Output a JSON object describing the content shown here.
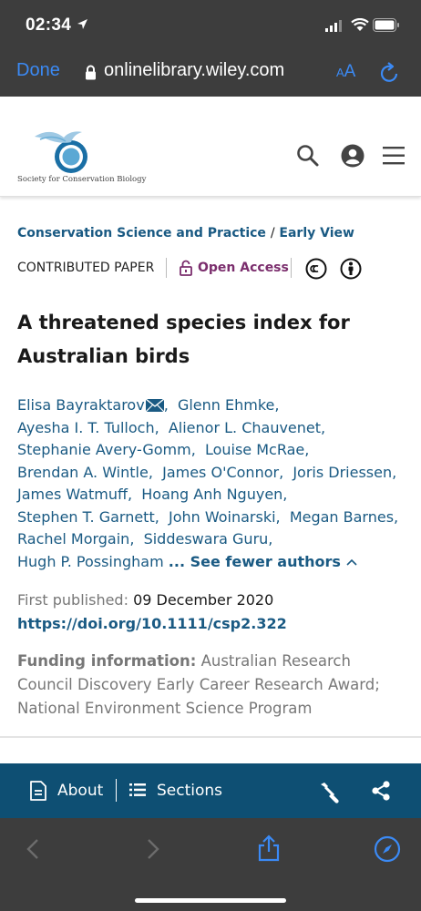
{
  "status_bar": {
    "time": "02:34"
  },
  "browser": {
    "done_label": "Done",
    "url": "onlinelibrary.wiley.com",
    "text_size_small": "A",
    "text_size_large": "A"
  },
  "site": {
    "logo_text": "Society for Conservation Biology"
  },
  "article": {
    "journal": "Conservation Science and Practice",
    "breadcrumb_sep": "/",
    "issue": "Early View",
    "paper_type": "CONTRIBUTED PAPER",
    "access": "Open Access",
    "title_line1": "A threatened species index for",
    "title_line2": "Australian birds",
    "authors": [
      "Elisa Bayraktarov",
      "Glenn Ehmke,",
      "Ayesha I. T. Tulloch,",
      "Alienor L. Chauvenet,",
      "Stephanie Avery-Gomm,",
      "Louise McRae,",
      "Brendan A. Wintle,",
      "James O'Connor,",
      "Joris Driessen,",
      "James Watmuff,",
      "Hoang Anh Nguyen,",
      "Stephen T. Garnett,",
      "John Woinarski,",
      "Megan Barnes,",
      "Rachel Morgain,",
      "Siddeswara Guru,",
      "Hugh P. Possingham"
    ],
    "see_fewer": "... See fewer authors",
    "first_published_label": "First published:",
    "first_published_date": "09 December 2020",
    "doi": "https://doi.org/10.1111/csp2.322",
    "funding_label": "Funding information:",
    "funding_text": "Australian Research Council Discovery Early Career Research Award; National Environment Science Program"
  },
  "toolbar": {
    "about_label": "About",
    "sections_label": "Sections"
  },
  "colors": {
    "link": "#1a5a83",
    "open_access": "#7b2e6d",
    "toolbar_bg": "#0e4f73",
    "safari_blue": "#3b8af5",
    "chrome_bg": "#3d3d3d"
  }
}
